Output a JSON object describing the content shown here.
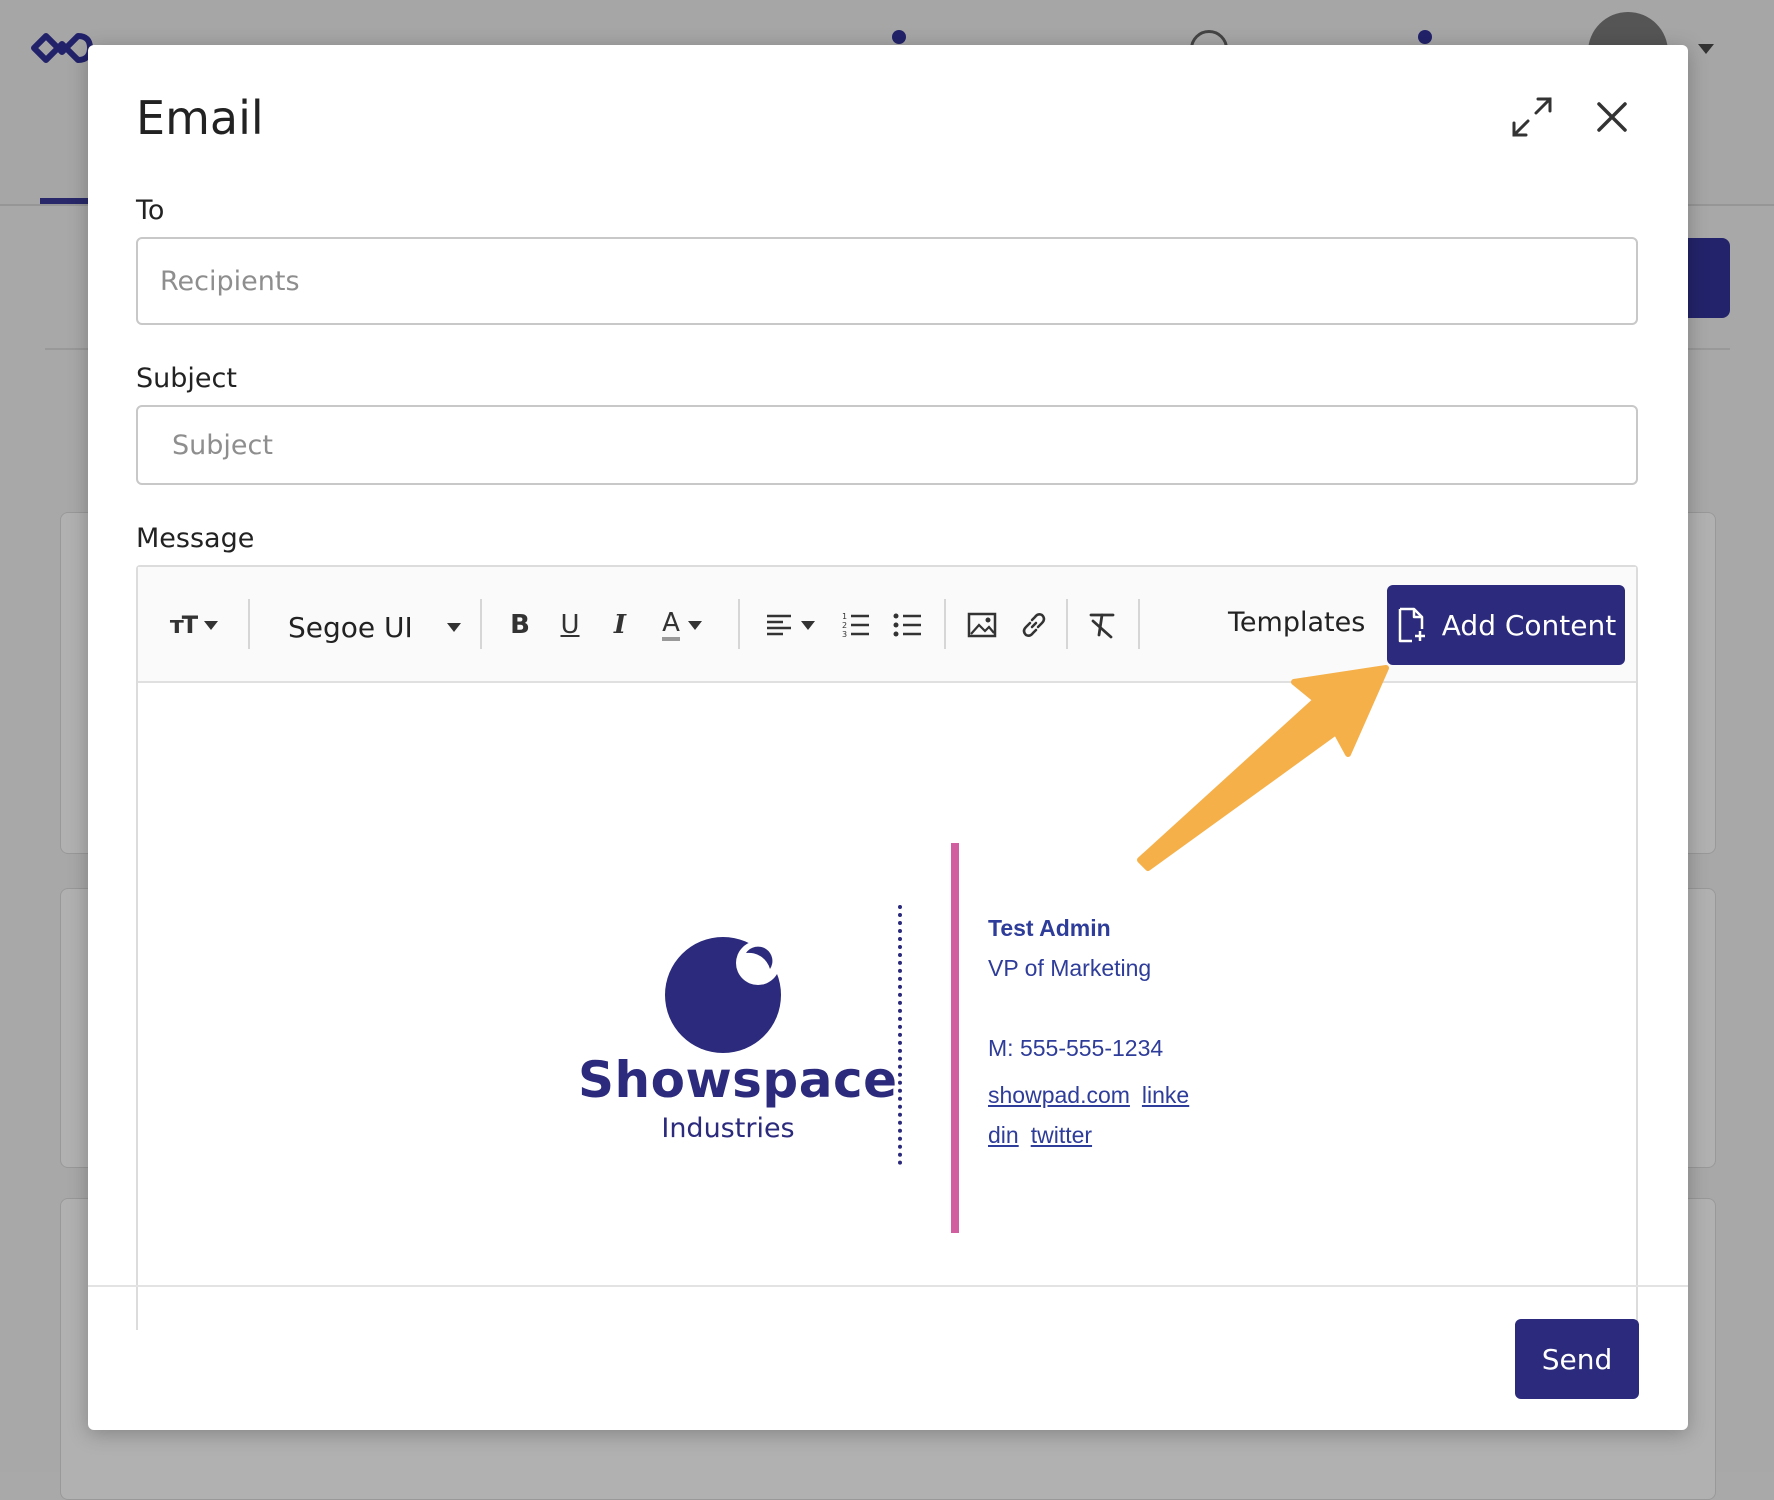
{
  "modal": {
    "title": "Email",
    "to_label": "To",
    "to_placeholder": "Recipients",
    "subject_label": "Subject",
    "subject_placeholder": "Subject",
    "message_label": "Message",
    "send_label": "Send"
  },
  "toolbar": {
    "font_name": "Segoe UI",
    "templates_label": "Templates",
    "add_content_label": "Add Content",
    "icons": [
      "text-size-icon",
      "bold-icon",
      "underline-icon",
      "italic-icon",
      "font-color-icon",
      "align-icon",
      "ordered-list-icon",
      "unordered-list-icon",
      "image-icon",
      "link-icon",
      "clear-format-icon"
    ]
  },
  "signature": {
    "company": "Showspace",
    "company_sub": "Industries",
    "name": "Test Admin",
    "role": "VP of Marketing",
    "phone": "M: 555-555-1234",
    "links": [
      "showpad.com",
      "linke",
      "din",
      "twitter"
    ]
  },
  "colors": {
    "brand_navy": "#2b2a7c",
    "accent_pink": "#d15e9e",
    "annotation_orange": "#f5b04a"
  }
}
